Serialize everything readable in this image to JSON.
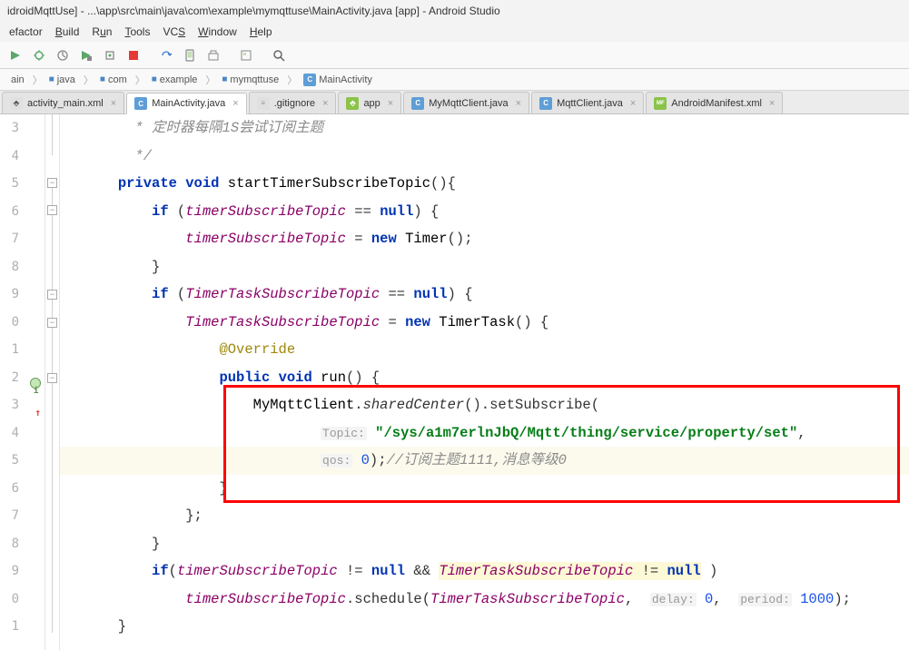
{
  "title": "idroidMqttUse] - ...\\app\\src\\main\\java\\com\\example\\mymqttuse\\MainActivity.java [app] - Android Studio",
  "menu": [
    "efactor",
    "Build",
    "Run",
    "Tools",
    "VCS",
    "Window",
    "Help"
  ],
  "breadcrumb": [
    "ain",
    "java",
    "com",
    "example",
    "mymqttuse",
    "MainActivity"
  ],
  "tabs": [
    {
      "label": "activity_main.xml",
      "icon": "x",
      "active": false
    },
    {
      "label": "MainActivity.java",
      "icon": "c",
      "active": true
    },
    {
      "label": ".gitignore",
      "icon": "g",
      "active": false
    },
    {
      "label": "app",
      "icon": "m",
      "active": false
    },
    {
      "label": "MyMqttClient.java",
      "icon": "c",
      "active": false
    },
    {
      "label": "MqttClient.java",
      "icon": "c",
      "active": false
    },
    {
      "label": "AndroidManifest.xml",
      "icon": "mf",
      "active": false
    }
  ],
  "gutter_lines": [
    "3",
    "4",
    "5",
    "6",
    "7",
    "8",
    "9",
    "0",
    "1",
    "2",
    "3",
    "4",
    "5",
    "6",
    "7",
    "8",
    "9",
    "0",
    "1"
  ],
  "code": {
    "c1": " * 定时器每隔1S尝试订阅主题",
    "c2": " */",
    "l5_private": "private",
    "l5_void": "void",
    "l5_method": "startTimerSubscribeTopic",
    "l6_if": "if",
    "l6_ident": "timerSubscribeTopic",
    "l6_null": "null",
    "l7_ident": "timerSubscribeTopic",
    "l7_new": "new",
    "l7_timer": "Timer",
    "l9_if": "if",
    "l9_ident": "TimerTaskSubscribeTopic",
    "l9_null": "null",
    "l10_ident": "TimerTaskSubscribeTopic",
    "l10_new": "new",
    "l10_type": "TimerTask",
    "l11_ann": "@Override",
    "l12_public": "public",
    "l12_void": "void",
    "l12_run": "run",
    "l13_client": "MyMqttClient",
    "l13_shared": "sharedCenter",
    "l13_sub": "setSubscribe",
    "l14_topic_hint": "Topic:",
    "l14_str": "\"/sys/a1m7erlnJbQ/Mqtt/thing/service/property/set\"",
    "l15_qos_hint": "qos:",
    "l15_num": "0",
    "l15_comment": "//订阅主题1111,消息等级0",
    "l19_if": "if",
    "l19_a": "timerSubscribeTopic",
    "l19_null": "null",
    "l19_b": "TimerTaskSubscribeTopic != null",
    "l20_ident": "timerSubscribeTopic",
    "l20_sched": "schedule",
    "l20_arg": "TimerTaskSubscribeTopic",
    "l20_delay_hint": "delay:",
    "l20_delay": "0",
    "l20_period_hint": "period:",
    "l20_period": "1000"
  }
}
